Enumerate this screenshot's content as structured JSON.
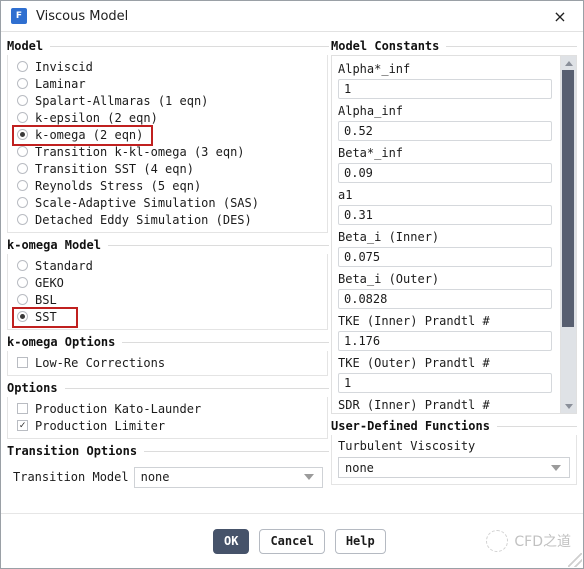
{
  "window": {
    "title": "Viscous Model",
    "icon": "fluent-app-icon",
    "icon_letter": "F",
    "close_label": "×"
  },
  "model_section": {
    "header": "Model",
    "options": [
      {
        "label": "Inviscid",
        "selected": false,
        "highlighted": false
      },
      {
        "label": "Laminar",
        "selected": false,
        "highlighted": false
      },
      {
        "label": "Spalart-Allmaras (1 eqn)",
        "selected": false,
        "highlighted": false
      },
      {
        "label": "k-epsilon (2 eqn)",
        "selected": false,
        "highlighted": false
      },
      {
        "label": "k-omega (2 eqn)",
        "selected": true,
        "highlighted": true
      },
      {
        "label": "Transition k-kl-omega (3 eqn)",
        "selected": false,
        "highlighted": false
      },
      {
        "label": "Transition SST (4 eqn)",
        "selected": false,
        "highlighted": false
      },
      {
        "label": "Reynolds Stress (5 eqn)",
        "selected": false,
        "highlighted": false
      },
      {
        "label": "Scale-Adaptive Simulation (SAS)",
        "selected": false,
        "highlighted": false
      },
      {
        "label": "Detached Eddy Simulation (DES)",
        "selected": false,
        "highlighted": false
      }
    ]
  },
  "komega_model_section": {
    "header": "k-omega Model",
    "options": [
      {
        "label": "Standard",
        "selected": false,
        "highlighted": false
      },
      {
        "label": "GEKO",
        "selected": false,
        "highlighted": false
      },
      {
        "label": "BSL",
        "selected": false,
        "highlighted": false
      },
      {
        "label": "SST",
        "selected": true,
        "highlighted": true
      }
    ]
  },
  "komega_options_section": {
    "header": "k-omega Options",
    "options": [
      {
        "label": "Low-Re Corrections",
        "checked": false
      }
    ]
  },
  "options_section": {
    "header": "Options",
    "options": [
      {
        "label": "Production Kato-Launder",
        "checked": false
      },
      {
        "label": "Production Limiter",
        "checked": true
      }
    ]
  },
  "transition_options_section": {
    "header": "Transition Options",
    "transition_model_label": "Transition Model",
    "transition_model_value": "none",
    "transition_model_options": [
      "none"
    ]
  },
  "model_constants_section": {
    "header": "Model Constants",
    "constants": [
      {
        "label": "Alpha*_inf",
        "value": "1"
      },
      {
        "label": "Alpha_inf",
        "value": "0.52"
      },
      {
        "label": "Beta*_inf",
        "value": "0.09"
      },
      {
        "label": "a1",
        "value": "0.31"
      },
      {
        "label": "Beta_i (Inner)",
        "value": "0.075"
      },
      {
        "label": "Beta_i (Outer)",
        "value": "0.0828"
      },
      {
        "label": "TKE (Inner) Prandtl #",
        "value": "1.176"
      },
      {
        "label": "TKE (Outer) Prandtl #",
        "value": "1"
      }
    ],
    "partial_label": "SDR (Inner) Prandtl #",
    "scroll_thumb_percent": 78
  },
  "udf_section": {
    "header": "User-Defined Functions",
    "turbulent_viscosity_label": "Turbulent Viscosity",
    "turbulent_viscosity_value": "none",
    "turbulent_viscosity_options": [
      "none"
    ]
  },
  "footer": {
    "ok_label": "OK",
    "cancel_label": "Cancel",
    "help_label": "Help",
    "watermark_text": "CFD之道"
  },
  "colors": {
    "highlight_red": "#c0201f",
    "primary_button": "#46536a",
    "scrollbar_thumb": "#585f70",
    "app_icon_blue": "#2f6fd0"
  }
}
